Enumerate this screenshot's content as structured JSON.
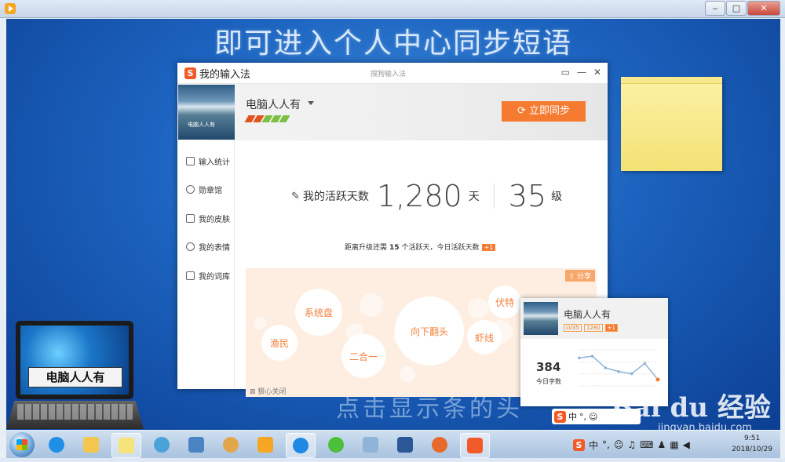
{
  "desktop": {
    "headline": "即可进入个人中心同步短语",
    "subline": "点击显示条的头"
  },
  "ime_window": {
    "title": "我的输入法",
    "center_title": "搜狗输入法",
    "user_name": "电脑人人有",
    "sync_button": "立即同步",
    "banner_caption": "电脑人人有",
    "sidebar": [
      {
        "label": "输入统计",
        "icon": "chart-icon"
      },
      {
        "label": "勋章馆",
        "icon": "medal-icon"
      },
      {
        "label": "我的皮肤",
        "icon": "shirt-icon"
      },
      {
        "label": "我的表情",
        "icon": "smile-icon"
      },
      {
        "label": "我的词库",
        "icon": "book-icon"
      }
    ],
    "stats": {
      "days_label": "我的活跃天数",
      "days_value": "1,280",
      "days_unit": "天",
      "level_value": "35",
      "level_unit": "级"
    },
    "upgrade_prefix": "距离升级还需",
    "upgrade_days": "15",
    "upgrade_suffix": "个活跃天，今日活跃天数",
    "today_badge": "+1",
    "share_label": "分享",
    "close_hint": "狠心关闭",
    "words": [
      "系统盘",
      "渔民",
      "二合一",
      "向下翻头",
      "伏特",
      "虾线"
    ]
  },
  "popup": {
    "name": "电脑人人有",
    "level_badge": "LV35",
    "days_badge": "1280",
    "plus_badge": "+1",
    "count": "384",
    "count_label": "今日字数"
  },
  "chart_data": {
    "type": "line",
    "values": [
      62,
      66,
      40,
      32,
      27,
      50,
      14
    ],
    "ylim": [
      0,
      80
    ]
  },
  "laptop": {
    "label": "电脑人人有"
  },
  "watermark": {
    "main": "Bai du 经验",
    "sub": "jingyan.baidu.com"
  },
  "tray": {
    "ime_label": "中",
    "punct": "°,"
  },
  "clock": {
    "time": "9:51",
    "date": "2018/10/29"
  },
  "colors": {
    "accent": "#f57b31",
    "desktop": "#1c63bf"
  }
}
